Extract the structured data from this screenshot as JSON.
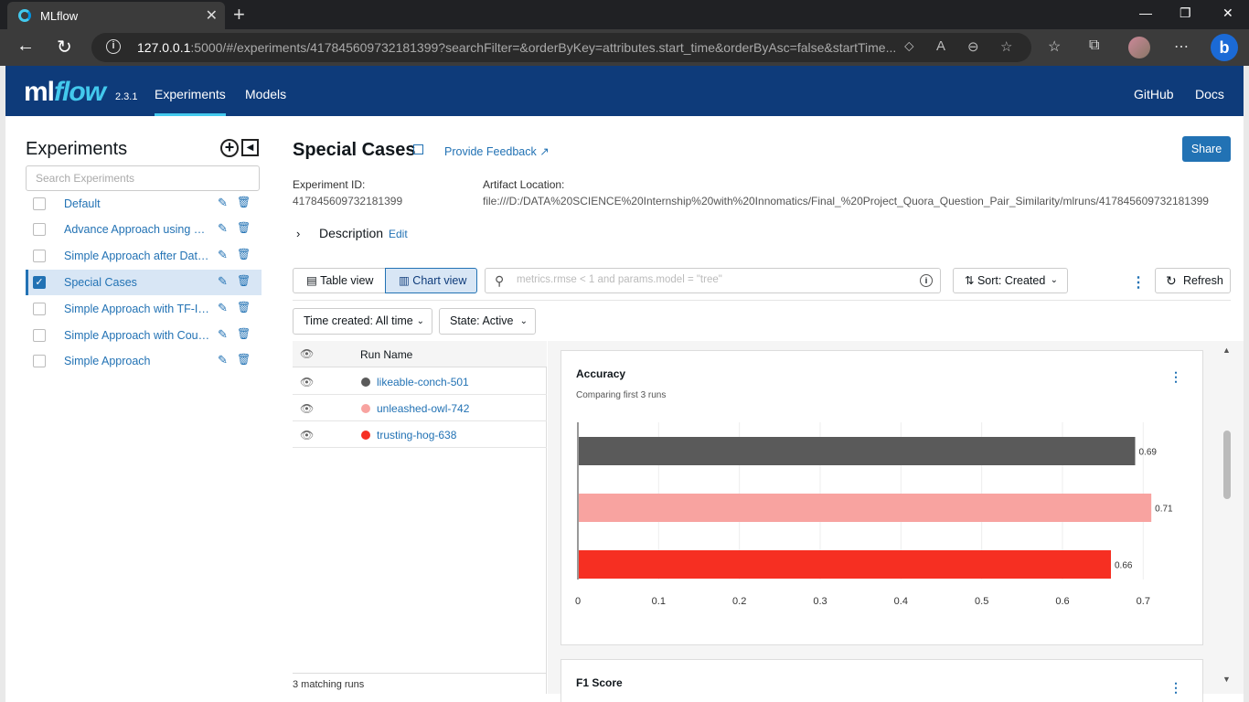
{
  "browser": {
    "tab_title": "MLflow",
    "url_host": "127.0.0.1",
    "url_rest": ":5000/#/experiments/417845609732181399?searchFilter=&orderByKey=attributes.start_time&orderByAsc=false&startTime..."
  },
  "header": {
    "logo_ml": "ml",
    "logo_flow": "flow",
    "version": "2.3.1",
    "nav": [
      "Experiments",
      "Models"
    ],
    "right_links": [
      "GitHub",
      "Docs"
    ]
  },
  "sidebar": {
    "title": "Experiments",
    "search_placeholder": "Search Experiments",
    "items": [
      {
        "label": "Default"
      },
      {
        "label": "Advance Approach using ext..."
      },
      {
        "label": "Simple Approach after Data ..."
      },
      {
        "label": "Special Cases"
      },
      {
        "label": "Simple Approach with TF-IDF"
      },
      {
        "label": "Simple Approach with Count..."
      },
      {
        "label": "Simple Approach"
      }
    ]
  },
  "experiment": {
    "name": "Special Cases",
    "feedback_label": "Provide Feedback",
    "share_label": "Share",
    "id_label": "Experiment ID:",
    "id_value": "417845609732181399",
    "artifact_label": "Artifact Location:",
    "artifact_value": "file:///D:/DATA%20SCIENCE%20Internship%20with%20Innomatics/Final_%20Project_Quora_Question_Pair_Similarity/mlruns/417845609732181399",
    "description_label": "Description",
    "description_edit": "Edit"
  },
  "toolbar": {
    "table_view": "Table view",
    "chart_view": "Chart view",
    "filter_placeholder": "metrics.rmse < 1 and params.model = \"tree\"",
    "sort_label": "Sort: Created",
    "refresh_label": "Refresh",
    "time_filter": "Time created: All time",
    "state_filter": "State: Active"
  },
  "runs_table": {
    "header": "Run Name",
    "rows": [
      {
        "name": "likeable-conch-501",
        "color": "#5a5a5a"
      },
      {
        "name": "unleashed-owl-742",
        "color": "#f8a3a0"
      },
      {
        "name": "trusting-hog-638",
        "color": "#f62f22"
      }
    ],
    "footer": "3 matching runs"
  },
  "charts": {
    "accuracy_title": "Accuracy",
    "accuracy_subtitle": "Comparing first 3 runs",
    "f1_title": "F1 Score"
  },
  "chart_data": {
    "type": "bar",
    "orientation": "horizontal",
    "title": "Accuracy",
    "subtitle": "Comparing first 3 runs",
    "categories": [
      "likeable-conch-501",
      "unleashed-owl-742",
      "trusting-hog-638"
    ],
    "values": [
      0.69,
      0.71,
      0.66
    ],
    "value_labels": [
      "0.69",
      "0.71",
      "0.66"
    ],
    "colors": [
      "#5a5a5a",
      "#f8a3a0",
      "#f62f22"
    ],
    "xlim": [
      0,
      0.72
    ],
    "xticks": [
      0,
      0.1,
      0.2,
      0.3,
      0.4,
      0.5,
      0.6,
      0.7
    ],
    "xtick_labels": [
      "0",
      "0.1",
      "0.2",
      "0.3",
      "0.4",
      "0.5",
      "0.6",
      "0.7"
    ],
    "grid": true
  },
  "colors": {
    "header_bg": "#0e3b7a",
    "accent": "#2272b4",
    "logo_accent": "#43c9ed"
  }
}
